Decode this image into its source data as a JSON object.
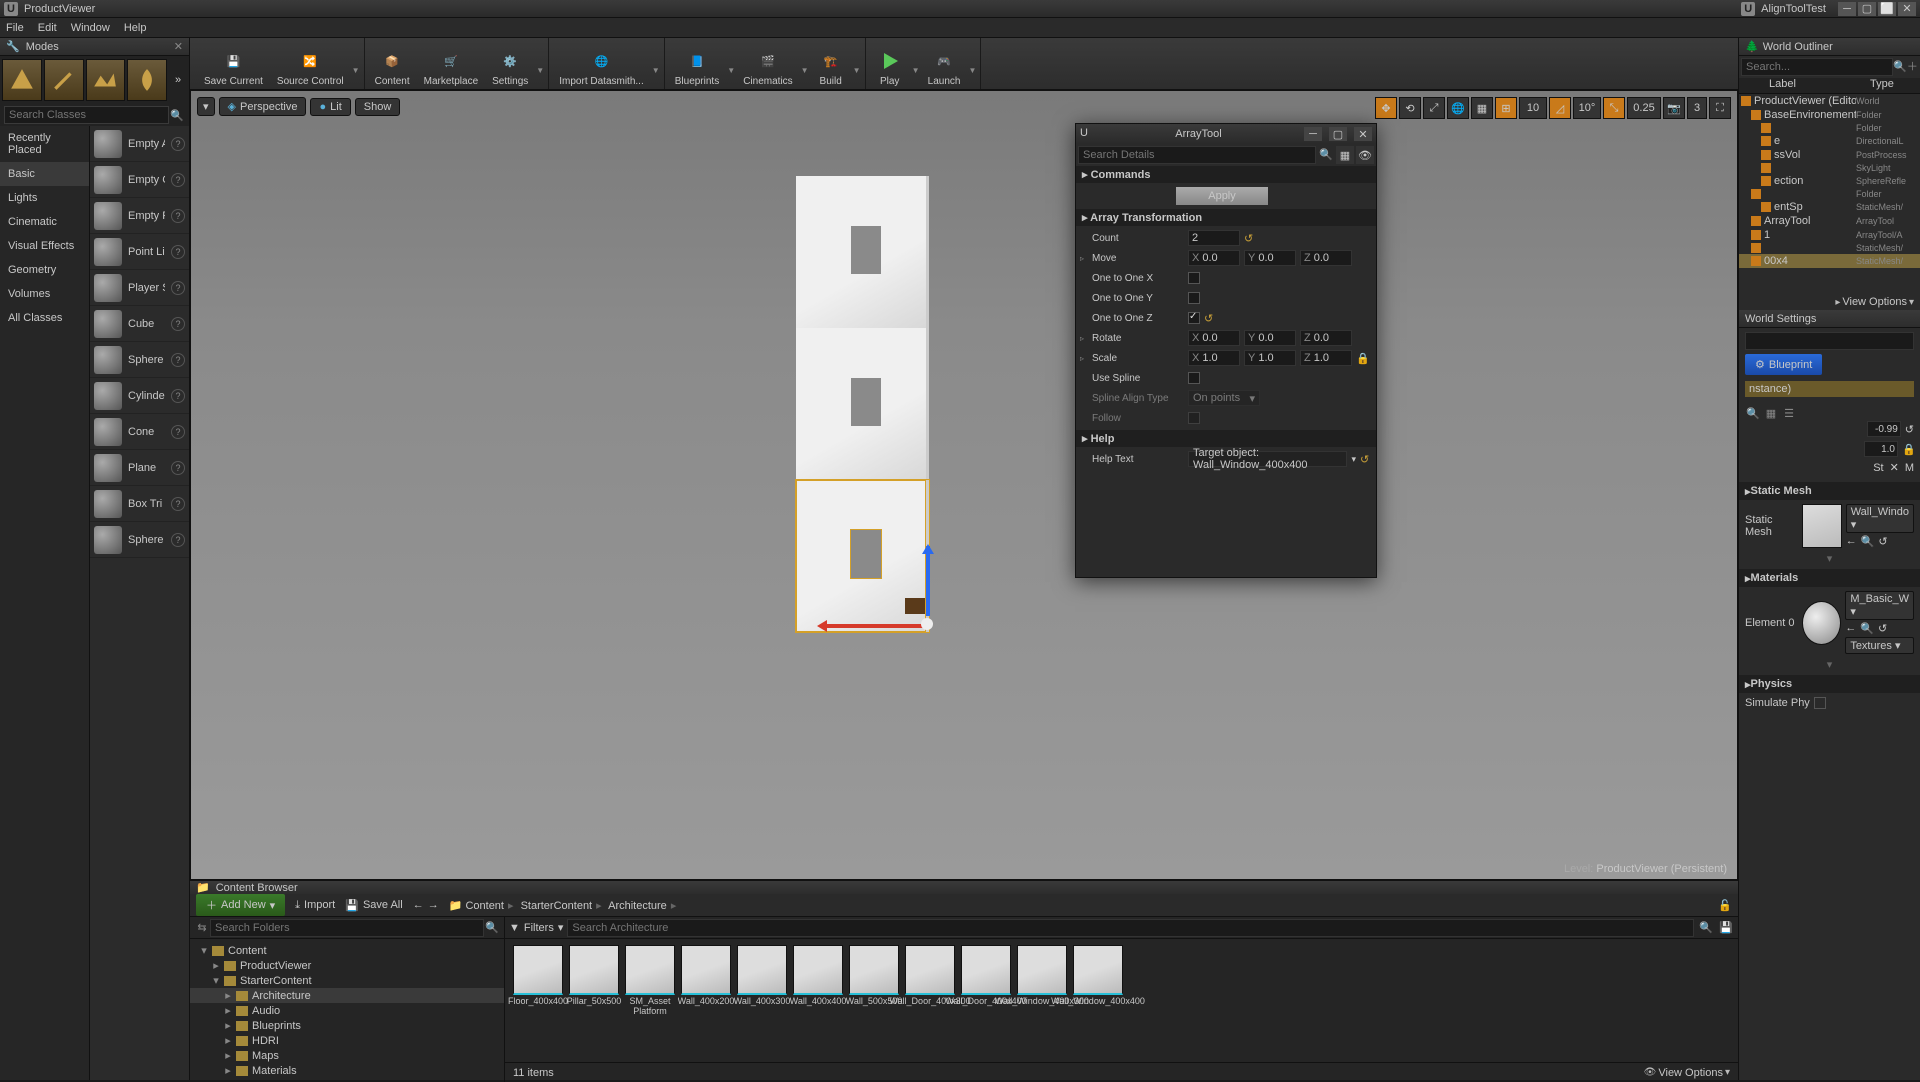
{
  "titlebar": {
    "title": "ProductViewer",
    "doc_title": "AlignToolTest"
  },
  "menu": {
    "file": "File",
    "edit": "Edit",
    "window": "Window",
    "help": "Help"
  },
  "modes": {
    "header": "Modes",
    "search_placeholder": "Search Classes",
    "categories": [
      "Recently Placed",
      "Basic",
      "Lights",
      "Cinematic",
      "Visual Effects",
      "Geometry",
      "Volumes",
      "All Classes"
    ],
    "active_category": "Basic",
    "items": [
      {
        "label": "Empty A"
      },
      {
        "label": "Empty C"
      },
      {
        "label": "Empty P"
      },
      {
        "label": "Point Li"
      },
      {
        "label": "Player S"
      },
      {
        "label": "Cube"
      },
      {
        "label": "Sphere"
      },
      {
        "label": "Cylinde"
      },
      {
        "label": "Cone"
      },
      {
        "label": "Plane"
      },
      {
        "label": "Box Tri"
      },
      {
        "label": "Sphere"
      }
    ]
  },
  "toolbar": {
    "save": "Save Current",
    "source": "Source Control",
    "content": "Content",
    "marketplace": "Marketplace",
    "settings": "Settings",
    "datasmith": "Import Datasmith...",
    "blueprints": "Blueprints",
    "cinematics": "Cinematics",
    "build": "Build",
    "play": "Play",
    "launch": "Launch"
  },
  "viewport": {
    "perspective": "Perspective",
    "lit": "Lit",
    "show": "Show",
    "snap_angle": "10",
    "snap_angle2": "10°",
    "snap_scale": "0.25",
    "cam_speed": "3",
    "level_label": "Level:",
    "level_name": "ProductViewer (Persistent)"
  },
  "outliner": {
    "header": "World Outliner",
    "search_placeholder": "Search...",
    "col_label": "Label",
    "col_type": "Type",
    "view_options": "View Options",
    "rows": [
      {
        "ind": 0,
        "label": "ProductViewer (Editor)",
        "type": "World"
      },
      {
        "ind": 1,
        "label": "BaseEnvironement",
        "type": "Folder"
      },
      {
        "ind": 2,
        "label": "",
        "type": "Folder"
      },
      {
        "ind": 2,
        "label": "e",
        "type": "DirectionalL"
      },
      {
        "ind": 2,
        "label": "ssVol",
        "type": "PostProcess"
      },
      {
        "ind": 2,
        "label": "",
        "type": "SkyLight"
      },
      {
        "ind": 2,
        "label": "ection",
        "type": "SphereRefle"
      },
      {
        "ind": 1,
        "label": "",
        "type": "Folder"
      },
      {
        "ind": 2,
        "label": "entSp",
        "type": "StaticMesh/"
      },
      {
        "ind": 1,
        "label": "ArrayTool",
        "type": "ArrayTool"
      },
      {
        "ind": 1,
        "label": "1",
        "type": "ArrayTool/A"
      },
      {
        "ind": 1,
        "label": "",
        "type": "StaticMesh/"
      },
      {
        "ind": 1,
        "label": "00x4",
        "type": "StaticMesh/",
        "selected": true
      }
    ]
  },
  "world_settings": {
    "header": "World Settings",
    "blueprint_btn": "Blueprint",
    "instance": "nstance)"
  },
  "details": {
    "static_mesh_hdr": "Static Mesh",
    "static_mesh_lbl": "Static Mesh",
    "static_mesh_val": "Wall_Windo",
    "materials_hdr": "Materials",
    "material_lbl": "Element 0",
    "material_val": "M_Basic_W",
    "textures_btn": "Textures",
    "physics_hdr": "Physics",
    "simulate_lbl": "Simulate Phy",
    "num_a": "-0.99",
    "num_b": "1.0",
    "scale": "St"
  },
  "array_tool": {
    "title": "ArrayTool",
    "search_placeholder": "Search Details",
    "sec_commands": "Commands",
    "apply": "Apply",
    "sec_transform": "Array Transformation",
    "count_lbl": "Count",
    "count_val": "2",
    "move_lbl": "Move",
    "move": {
      "x": "0.0",
      "y": "0.0",
      "z": "0.0"
    },
    "o2o_x": "One to One X",
    "o2o_y": "One to One Y",
    "o2o_z": "One to One Z",
    "rotate_lbl": "Rotate",
    "rotate": {
      "x": "0.0",
      "y": "0.0",
      "z": "0.0"
    },
    "scale_lbl": "Scale",
    "scale": {
      "x": "1.0",
      "y": "1.0",
      "z": "1.0"
    },
    "spline_lbl": "Use Spline",
    "spline_align_lbl": "Spline Align Type",
    "spline_align_val": "On points",
    "follow_lbl": "Follow",
    "sec_help": "Help",
    "help_lbl": "Help Text",
    "help_val": "Target object: Wall_Window_400x400"
  },
  "cb": {
    "header": "Content Browser",
    "add_new": "Add New",
    "import": "Import",
    "save_all": "Save All",
    "crumbs": [
      "Content",
      "StarterContent",
      "Architecture"
    ],
    "folders_placeholder": "Search Folders",
    "filters": "Filters",
    "assets_placeholder": "Search Architecture",
    "tree": [
      {
        "d": 0,
        "label": "Content",
        "open": true
      },
      {
        "d": 1,
        "label": "ProductViewer"
      },
      {
        "d": 1,
        "label": "StarterContent",
        "open": true
      },
      {
        "d": 2,
        "label": "Architecture",
        "active": true
      },
      {
        "d": 2,
        "label": "Audio"
      },
      {
        "d": 2,
        "label": "Blueprints"
      },
      {
        "d": 2,
        "label": "HDRI"
      },
      {
        "d": 2,
        "label": "Maps"
      },
      {
        "d": 2,
        "label": "Materials"
      }
    ],
    "assets": [
      "Floor_400x400",
      "Pillar_50x500",
      "SM_Asset Platform",
      "Wall_400x200",
      "Wall_400x300",
      "Wall_400x400",
      "Wall_500x500",
      "Wall_Door_400x300",
      "Wall_Door_400x400",
      "Wall_Window_400x300",
      "Wall_Window_400x400"
    ],
    "item_count": "11 items",
    "view_options": "View Options"
  }
}
